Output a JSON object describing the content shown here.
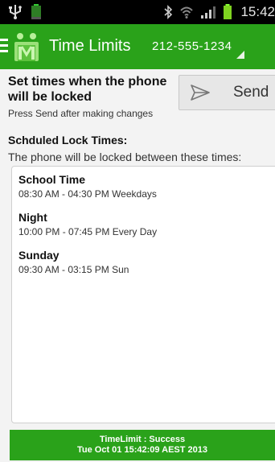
{
  "status_bar": {
    "time": "15:42",
    "icons": [
      "usb-icon",
      "battery-icon",
      "bluetooth-icon",
      "wifi-icon",
      "signal-icon",
      "battery-icon"
    ]
  },
  "action_bar": {
    "title": "Time Limits",
    "phone_number": "212-555-1234",
    "icons": [
      "menu-icon",
      "app-logo-icon",
      "spinner-arrow-icon"
    ]
  },
  "header": {
    "heading": "Set times when the phone will be locked",
    "hint": "Press Send after making changes",
    "send_label": "Send",
    "send_icon": "send-icon"
  },
  "schedule": {
    "title": "Schduled Lock Times:",
    "subtitle": "The phone will be locked between these times:",
    "items": [
      {
        "name": "School Time",
        "time": "08:30 AM - 04:30 PM Weekdays"
      },
      {
        "name": "Night",
        "time": "10:00 PM - 07:45 PM Every Day"
      },
      {
        "name": "Sunday",
        "time": "09:30 AM - 03:15 PM Sun"
      }
    ]
  },
  "footer": {
    "line1": "TimeLimit : Success",
    "line2": "Tue Oct 01 15:42:09 AEST 2013"
  },
  "colors": {
    "accent": "#2aa21a",
    "status_bar": "#000000",
    "background": "#f3f3f3"
  }
}
